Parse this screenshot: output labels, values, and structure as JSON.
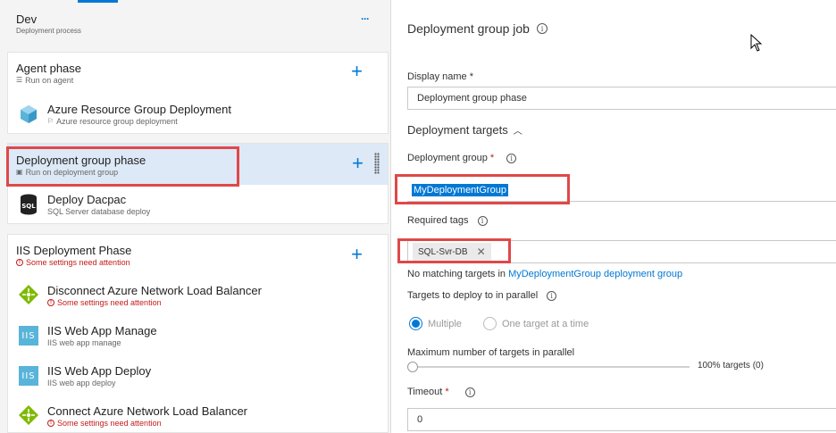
{
  "environment": {
    "name": "Dev",
    "subtitle": "Deployment process",
    "more_label": "···"
  },
  "phases": [
    {
      "name": "Agent phase",
      "subtitle": "Run on agent",
      "tasks": [
        {
          "name": "Azure Resource Group Deployment",
          "subtitle": "Azure resource group deployment",
          "icon": "azure-resource-group-icon"
        }
      ]
    },
    {
      "name": "Deployment group phase",
      "subtitle": "Run on deployment group",
      "selected": true,
      "tasks": [
        {
          "name": "Deploy Dacpac",
          "subtitle": "SQL Server database deploy",
          "icon": "sql-icon",
          "icon_text": "SQL"
        }
      ]
    },
    {
      "name": "IIS Deployment Phase",
      "subtitle": "Some settings need attention",
      "warning": true,
      "tasks": [
        {
          "name": "Disconnect Azure Network Load Balancer",
          "subtitle": "Some settings need attention",
          "warning": true,
          "icon": "load-balancer-icon"
        },
        {
          "name": "IIS Web App Manage",
          "subtitle": "IIS web app manage",
          "icon": "iis-icon",
          "icon_text": "IIS"
        },
        {
          "name": "IIS Web App Deploy",
          "subtitle": "IIS web app deploy",
          "icon": "iis-icon",
          "icon_text": "IIS"
        },
        {
          "name": "Connect Azure Network Load Balancer",
          "subtitle": "Some settings need attention",
          "warning": true,
          "icon": "load-balancer-icon"
        }
      ]
    }
  ],
  "details": {
    "title": "Deployment group job",
    "display_name_label": "Display name *",
    "display_name_value": "Deployment group phase",
    "targets_section": "Deployment targets",
    "deployment_group_label": "Deployment group",
    "deployment_group_required": "*",
    "deployment_group_value": "MyDeploymentGroup",
    "required_tags_label": "Required tags",
    "tag_value": "SQL-Svr-DB",
    "no_match_prefix": "No matching targets in ",
    "no_match_link": "MyDeploymentGroup deployment group",
    "parallel_label": "Targets to deploy to in parallel",
    "option_multiple": "Multiple",
    "option_one": "One target at a time",
    "max_label": "Maximum number of targets in parallel",
    "slider_value_text": "100% targets (0)",
    "slider_level": 0,
    "timeout_label": "Timeout",
    "timeout_required": "*",
    "timeout_value": "0"
  },
  "colors": {
    "accent": "#0078d4",
    "highlight": "#e04848",
    "warning": "#c21b1b",
    "selected_bg": "#dde9f6"
  }
}
